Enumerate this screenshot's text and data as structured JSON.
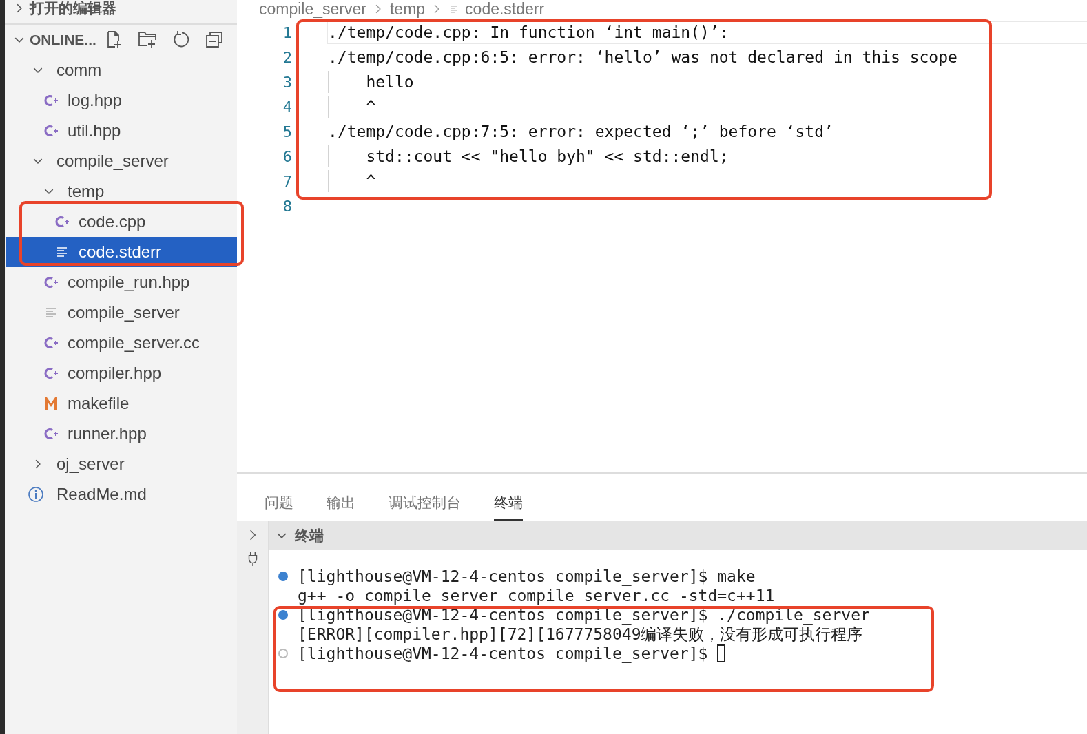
{
  "open_editors": {
    "title": "打开的编辑器",
    "expanded": false
  },
  "explorer": {
    "title": "ONLINE...",
    "expanded": true,
    "tree": [
      {
        "name": "comm",
        "kind": "folder",
        "expanded": true,
        "selected": false,
        "children": [
          {
            "name": "log.hpp",
            "kind": "cpp",
            "selected": false
          },
          {
            "name": "util.hpp",
            "kind": "cpp",
            "selected": false
          }
        ]
      },
      {
        "name": "compile_server",
        "kind": "folder",
        "expanded": true,
        "selected": false,
        "children": [
          {
            "name": "temp",
            "kind": "folder",
            "expanded": true,
            "selected": false,
            "children": [
              {
                "name": "code.cpp",
                "kind": "cpp",
                "selected": false
              },
              {
                "name": "code.stderr",
                "kind": "text",
                "selected": true
              }
            ]
          },
          {
            "name": "compile_run.hpp",
            "kind": "cpp",
            "selected": false
          },
          {
            "name": "compile_server",
            "kind": "text",
            "selected": false
          },
          {
            "name": "compile_server.cc",
            "kind": "cpp",
            "selected": false
          },
          {
            "name": "compiler.hpp",
            "kind": "cpp",
            "selected": false
          },
          {
            "name": "makefile",
            "kind": "make",
            "selected": false
          },
          {
            "name": "runner.hpp",
            "kind": "cpp",
            "selected": false
          }
        ]
      },
      {
        "name": "oj_server",
        "kind": "folder",
        "expanded": false,
        "selected": false
      },
      {
        "name": "ReadMe.md",
        "kind": "info",
        "selected": false
      }
    ]
  },
  "breadcrumb": [
    {
      "label": "compile_server"
    },
    {
      "label": "temp"
    },
    {
      "label": "code.stderr",
      "kind": "text"
    }
  ],
  "editor": {
    "lines": [
      {
        "number": "1",
        "text": "./temp/code.cpp: In function ‘int main()’:",
        "current": true
      },
      {
        "number": "2",
        "text": "./temp/code.cpp:6:5: error: ‘hello’ was not declared in this scope",
        "current": false
      },
      {
        "number": "3",
        "text": "    hello",
        "current": false
      },
      {
        "number": "4",
        "text": "    ^",
        "current": false
      },
      {
        "number": "5",
        "text": "./temp/code.cpp:7:5: error: expected ‘;’ before ‘std’",
        "current": false
      },
      {
        "number": "6",
        "text": "    std::cout << \"hello byh\" << std::endl;",
        "current": false
      },
      {
        "number": "7",
        "text": "    ^",
        "current": false
      },
      {
        "number": "8",
        "current": false
      }
    ]
  },
  "panel": {
    "tabs": [
      {
        "label": "问题",
        "selected": false
      },
      {
        "label": "输出",
        "selected": false
      },
      {
        "label": "调试控制台",
        "selected": false
      },
      {
        "label": "终端",
        "selected": true
      }
    ],
    "terminal_title": "终端",
    "terminal_expanded": true,
    "lines": [
      {
        "text": "[lighthouse@VM-12-4-centos compile_server]$ make",
        "success": true,
        "cursor": false
      },
      {
        "text": "g++ -o compile_server compile_server.cc -std=c++11",
        "cursor": false
      },
      {
        "text": "[lighthouse@VM-12-4-centos compile_server]$ ./compile_server",
        "success": true,
        "cursor": false
      },
      {
        "text": "[ERROR][compiler.hpp][72][1677758049编译失败，没有形成可执行程序",
        "cursor": false
      },
      {
        "text": "[lighthouse@VM-12-4-centos compile_server]$ ",
        "success": false,
        "cursor": true
      }
    ]
  }
}
